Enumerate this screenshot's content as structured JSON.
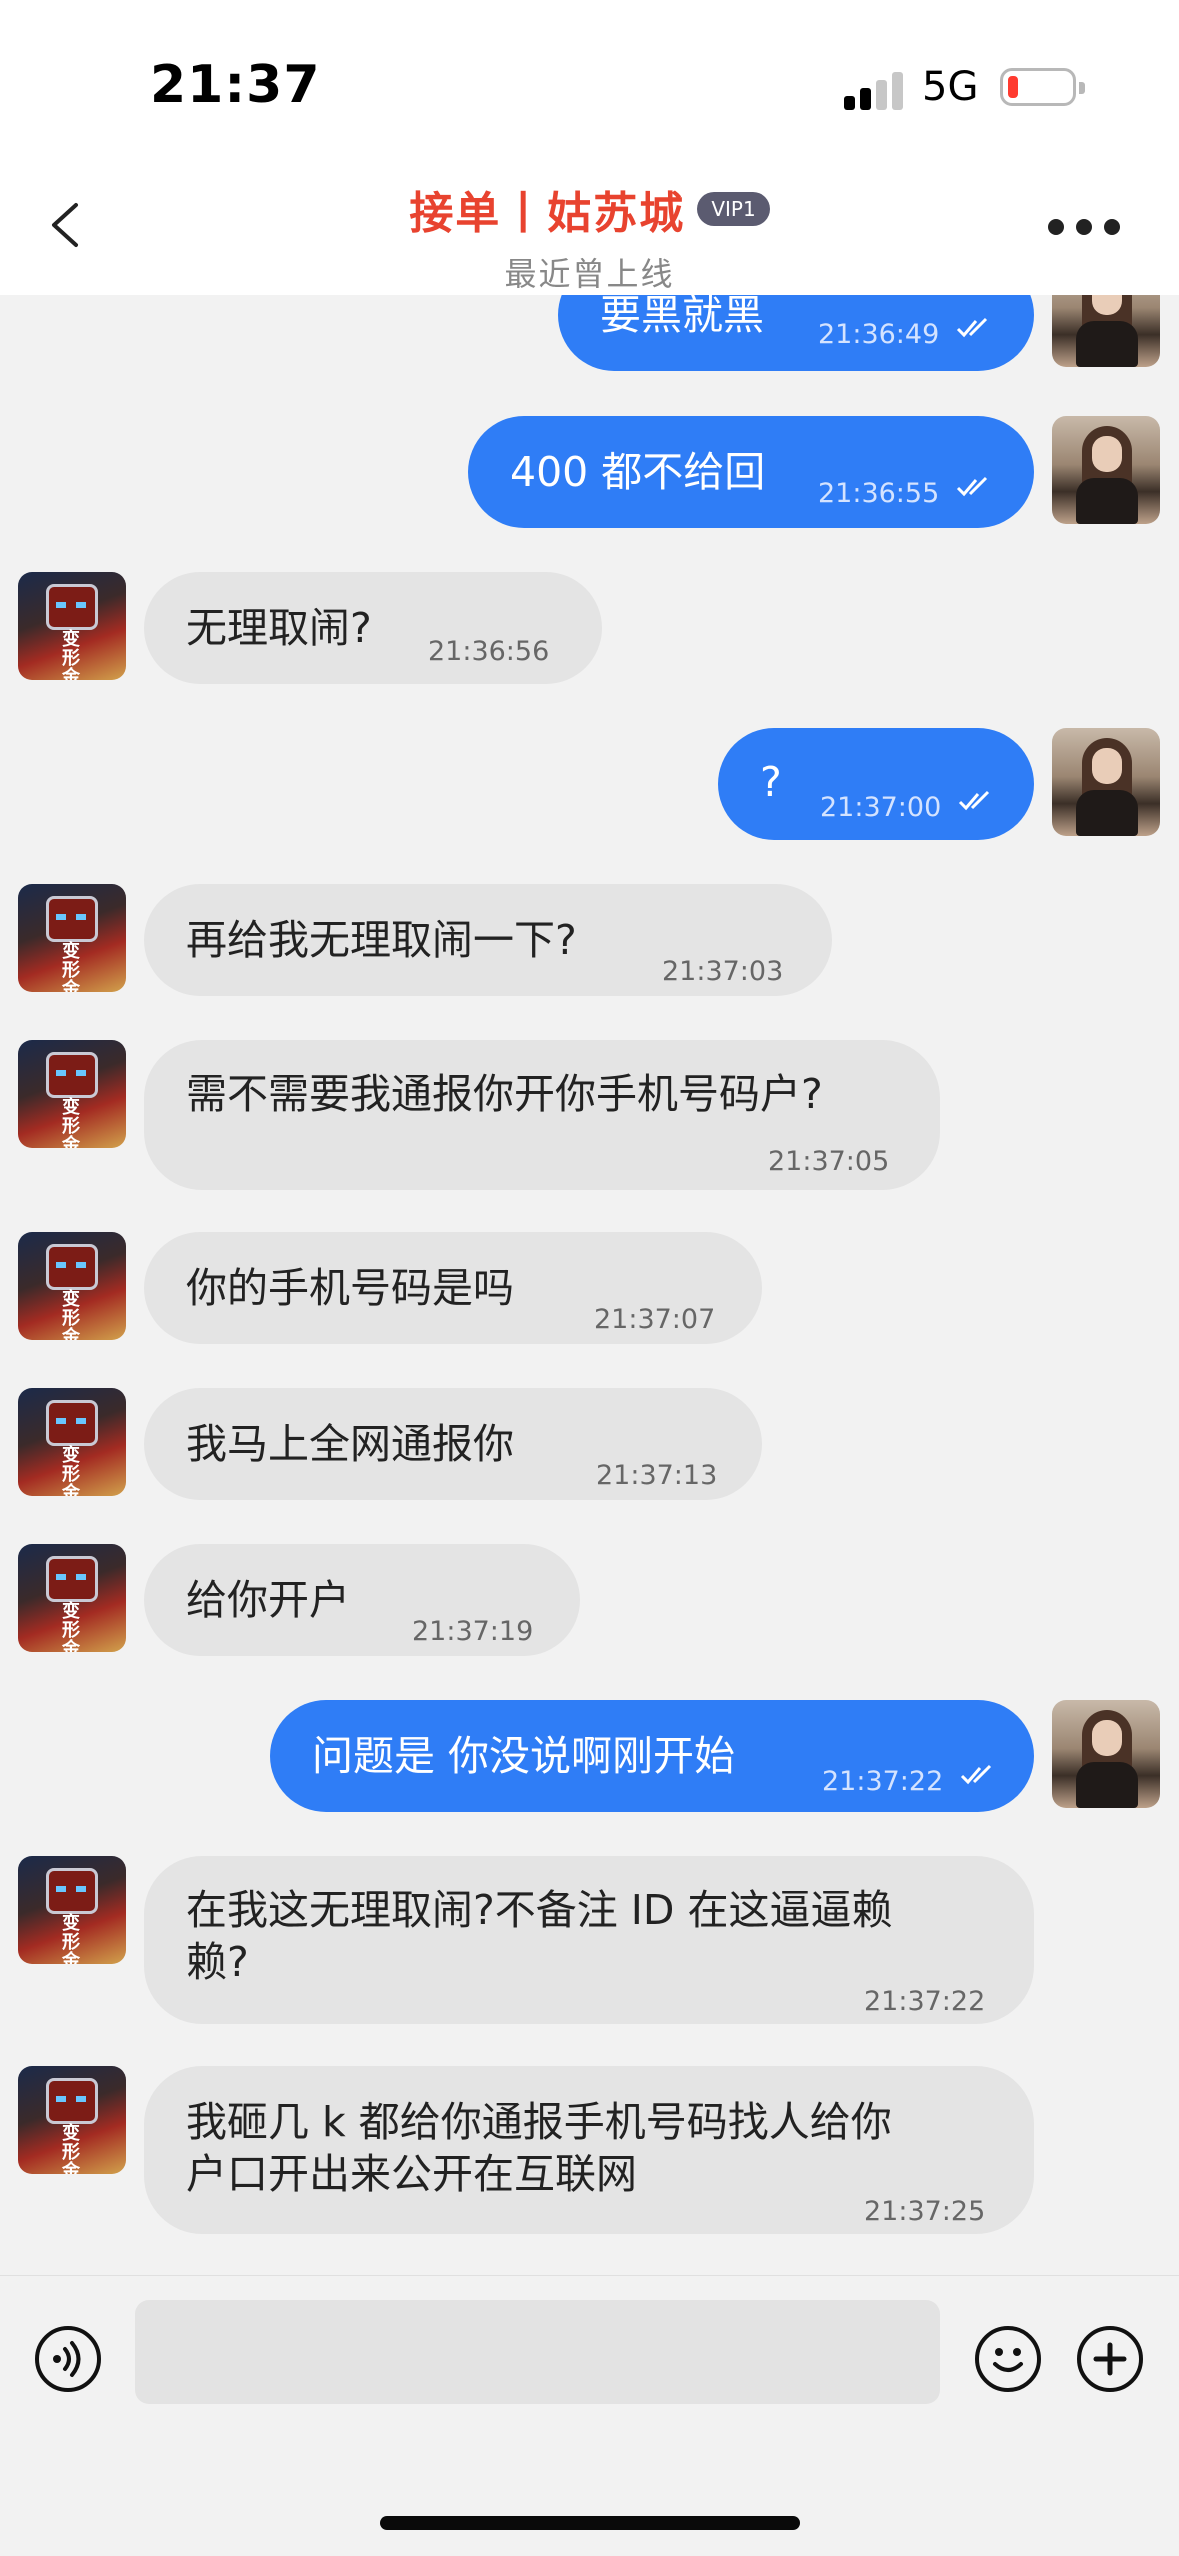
{
  "status_bar": {
    "time": "21:37",
    "network": "5G",
    "battery_level": 0.1
  },
  "header": {
    "title": "接单丨姑苏城",
    "vip_badge": "VIP1",
    "subtitle": "最近曾上线"
  },
  "messages": [
    {
      "side": "out",
      "text": "要黑就黑",
      "time": "21:36:49"
    },
    {
      "side": "out",
      "text": "400 都不给回",
      "time": "21:36:55"
    },
    {
      "side": "in",
      "text": "无理取闹?",
      "time": "21:36:56"
    },
    {
      "side": "out",
      "text": "?",
      "time": "21:37:00"
    },
    {
      "side": "in",
      "text": "再给我无理取闹一下?",
      "time": "21:37:03"
    },
    {
      "side": "in",
      "text": "需不需要我通报你开你手机号码户?",
      "time": "21:37:05"
    },
    {
      "side": "in",
      "text": "你的手机号码是吗",
      "time": "21:37:07"
    },
    {
      "side": "in",
      "text": "我马上全网通报你",
      "time": "21:37:13"
    },
    {
      "side": "in",
      "text": "给你开户",
      "time": "21:37:19"
    },
    {
      "side": "out",
      "text": "问题是 你没说啊刚开始",
      "time": "21:37:22"
    },
    {
      "side": "in",
      "text_lines": [
        "在我这无理取闹?不备注 ID 在这逼逼赖",
        "赖?"
      ],
      "time": "21:37:22"
    },
    {
      "side": "in",
      "text_lines": [
        "我砸几 k 都给你通报手机号码找人给你",
        "户口开出来公开在互联网"
      ],
      "time": "21:37:25"
    }
  ],
  "avatar_robot_text": "变形金刚",
  "input": {
    "placeholder": ""
  },
  "colors": {
    "accent_title": "#e8432f",
    "out_bubble": "#2f7df6",
    "in_bubble": "#e4e4e4",
    "background": "#f2f2f2"
  },
  "icons": [
    "back-icon",
    "more-icon",
    "voice-icon",
    "emoji-icon",
    "plus-icon",
    "read-check-icon"
  ]
}
